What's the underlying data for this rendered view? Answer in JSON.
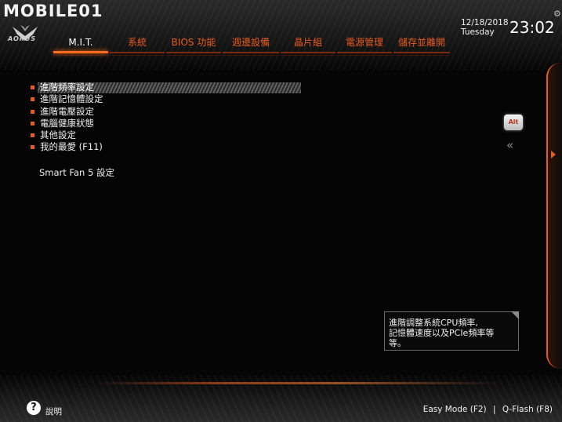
{
  "watermark": "MOBILE01",
  "brand": {
    "name": "AORUS"
  },
  "datetime": {
    "date": "12/18/2018",
    "day": "Tuesday",
    "time": "23:02"
  },
  "tabs": [
    {
      "label": "M.I.T.",
      "active": true
    },
    {
      "label": "系統"
    },
    {
      "label": "BIOS 功能"
    },
    {
      "label": "週邊設備"
    },
    {
      "label": "晶片組"
    },
    {
      "label": "電源管理"
    },
    {
      "label": "儲存並離開"
    }
  ],
  "menu": {
    "items": [
      {
        "label": "進階頻率設定",
        "selected": true
      },
      {
        "label": "進階記憶體設定"
      },
      {
        "label": "進階電壓設定"
      },
      {
        "label": "電腦健康狀態"
      },
      {
        "label": "其他設定"
      },
      {
        "label": "我的最愛 (F11)"
      }
    ],
    "smart_fan": "Smart Fan 5 設定"
  },
  "side": {
    "alt_label": "Alt",
    "collapse_icon": "double-chevron-left-icon"
  },
  "help_box": {
    "lines": [
      "進階調整系統CPU頻率,",
      "記憶體速度以及PCIe頻率等",
      "等。"
    ]
  },
  "footer": {
    "help_icon": "?",
    "help_label": "說明",
    "easy_mode": "Easy Mode (F2)",
    "separator": "|",
    "qflash": "Q-Flash (F8)"
  },
  "colors": {
    "accent": "#e85b1e",
    "background": "#050505",
    "text": "#f0f0f0"
  }
}
